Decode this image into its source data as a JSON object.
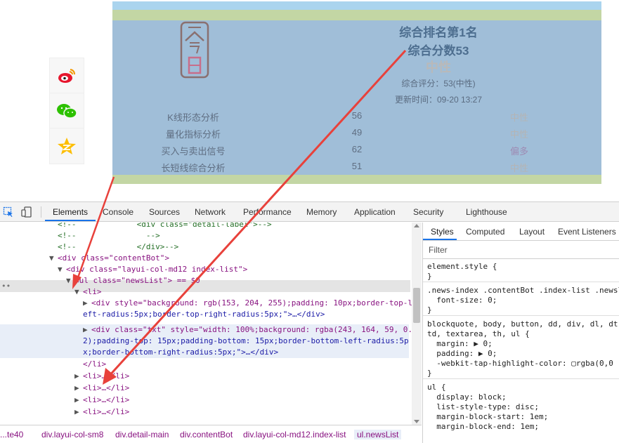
{
  "widget": {
    "rank_line": "综合排名第1名",
    "score_line": "综合分数53",
    "neutral_label": "中性",
    "eval_text": "综合评分：53(中性)",
    "update_text": "更新时间：09-20 13:27",
    "rows": [
      {
        "name": "K线形态分析",
        "value": "56",
        "status": "中性"
      },
      {
        "name": "量化指标分析",
        "value": "49",
        "status": "中性"
      },
      {
        "name": "买入与卖出信号",
        "value": "62",
        "status": "偏多"
      },
      {
        "name": "长短线综合分析",
        "value": "51",
        "status": "中性"
      }
    ]
  },
  "devtools": {
    "tabs": [
      "Elements",
      "Console",
      "Sources",
      "Network",
      "Performance",
      "Memory",
      "Application",
      "Security",
      "Lighthouse"
    ],
    "dom_lines": [
      "<!--             <div class=\"detail-label\">-->",
      "<!--               -->",
      "<!--             </div>-->",
      "<div class=\"contentBot\">",
      "<div class=\"layui-col-md12 index-list\">",
      "<ul class=\"newsList\"> == $0",
      "<li>",
      "<div style=\"background: rgb(153, 204, 255);padding: 10px;border-top-l",
      "eft-radius:5px;border-top-right-radius:5px;\">…</div>",
      "<div class=\"txt\" style=\"width: 100%;background: rgba(243, 164, 59, 0.",
      "2);padding-top: 15px;padding-bottom: 15px;border-bottom-left-radius:5p",
      "x;border-bottom-right-radius:5px;\">…</div>",
      "</li>",
      "<li>…</li>",
      "<li>…</li>",
      "<li>…</li>",
      "<li>…</li>"
    ],
    "breadcrumbs": [
      "...te40",
      "div.layui-col-sm8",
      "div.detail-main",
      "div.contentBot",
      "div.layui-col-md12.index-list",
      "ul.newsList"
    ],
    "styles_tabs": [
      "Styles",
      "Computed",
      "Layout",
      "Event Listeners"
    ],
    "filter_placeholder": "Filter",
    "styles_lines": [
      "element.style {",
      "}",
      ".news-index .contentBot .index-list .newsl",
      "  font-size: 0;",
      "}",
      "blockquote, body, button, dd, div, dl, dt,",
      "td, textarea, th, ul {",
      "  margin: ▶ 0;",
      "  padding: ▶ 0;",
      "  -webkit-tap-highlight-color: ▢rgba(0,0",
      "}",
      "ul {",
      "  display: block;",
      "  list-style-type: disc;",
      "  margin-block-start: 1em;",
      "  margin-block-end: 1em;"
    ]
  },
  "colors": {
    "widget_bg": "#a0bed8",
    "arrow": "#e8413b",
    "active_tab": "#1a73e8"
  }
}
